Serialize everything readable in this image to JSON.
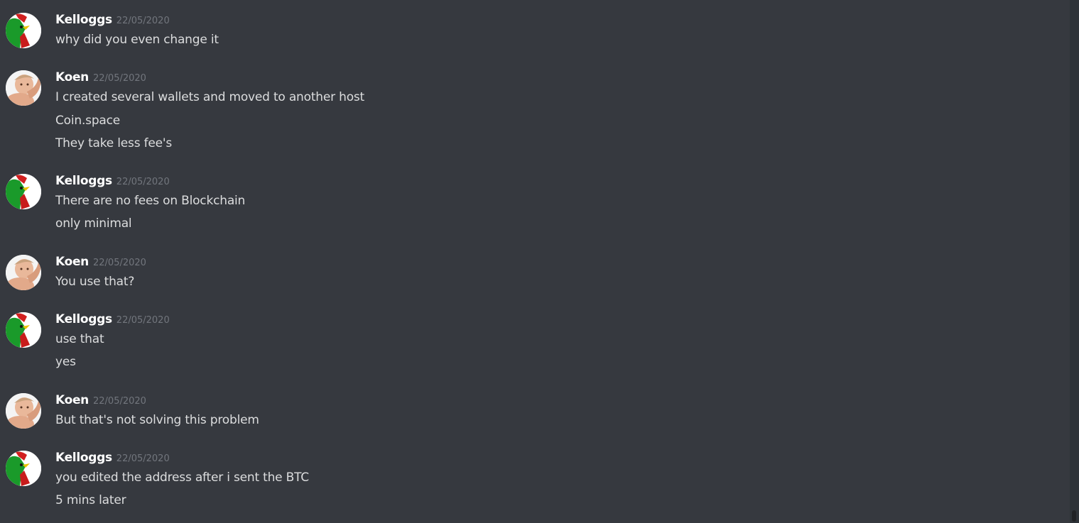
{
  "messages": [
    {
      "author": "Kelloggs",
      "avatar_icon": "kelloggs-rooster-avatar",
      "timestamp": "22/05/2020",
      "lines": [
        "why did you even change it"
      ]
    },
    {
      "author": "Koen",
      "avatar_icon": "koen-baby-photo-avatar",
      "timestamp": "22/05/2020",
      "lines": [
        "I created several wallets and moved to another host",
        "Coin.space",
        "They take less fee's"
      ]
    },
    {
      "author": "Kelloggs",
      "avatar_icon": "kelloggs-rooster-avatar",
      "timestamp": "22/05/2020",
      "lines": [
        "There are no fees on Blockchain",
        "only minimal"
      ]
    },
    {
      "author": "Koen",
      "avatar_icon": "koen-baby-photo-avatar",
      "timestamp": "22/05/2020",
      "lines": [
        "You use that?"
      ]
    },
    {
      "author": "Kelloggs",
      "avatar_icon": "kelloggs-rooster-avatar",
      "timestamp": "22/05/2020",
      "lines": [
        "use that",
        "yes"
      ]
    },
    {
      "author": "Koen",
      "avatar_icon": "koen-baby-photo-avatar",
      "timestamp": "22/05/2020",
      "lines": [
        "But that's not solving this problem"
      ]
    },
    {
      "author": "Kelloggs",
      "avatar_icon": "kelloggs-rooster-avatar",
      "timestamp": "22/05/2020",
      "lines": [
        "you edited the address after i sent the BTC",
        "5 mins later"
      ]
    }
  ],
  "colors": {
    "background": "#36393f",
    "username": "#ffffff",
    "timestamp": "#72767d",
    "message_text": "#dcddde"
  }
}
